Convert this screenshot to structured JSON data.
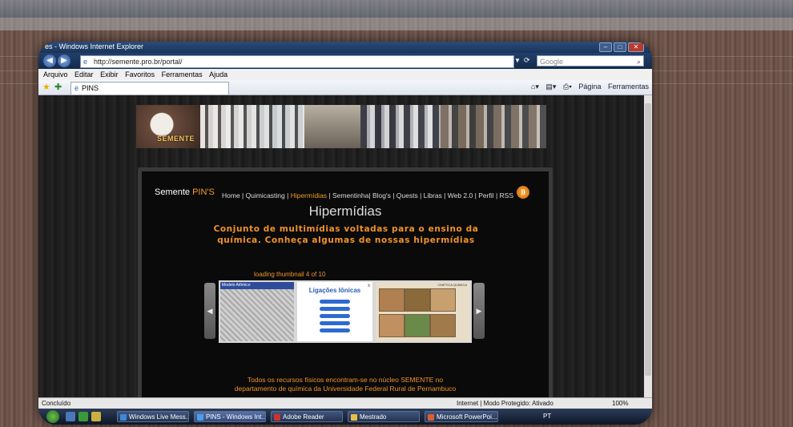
{
  "background": {
    "taskbar_items": [
      "",
      "",
      "",
      "",
      "",
      "",
      ""
    ],
    "address_text": "",
    "right_text": ""
  },
  "window": {
    "title": "es - Windows Internet Explorer",
    "address": "http://semente.pro.br/portal/",
    "search_placeholder": "Google",
    "menu": [
      "Arquivo",
      "Editar",
      "Exibir",
      "Favoritos",
      "Ferramentas",
      "Ajuda"
    ],
    "tab_label": "PINS",
    "command_bar": [
      "Página",
      "Ferramentas"
    ]
  },
  "page": {
    "banner_logo": "SEMENTE",
    "site_title_main": "Semente ",
    "site_title_accent": "PIN'S",
    "nav": {
      "home": "Home",
      "quimicasting": "Quimicasting",
      "hipermidias": "Hipermídias",
      "sementinha": "Sementinha",
      "blogs": "Blog's",
      "quests": "Quests",
      "libras": "Libras",
      "web20": "Web 2.0",
      "perfil": "Perfil",
      "rss": "RSS"
    },
    "heading": "Hipermídias",
    "subheading": "Conjunto de multimídias voltadas para o ensino da química. Conheça algumas de nossas hipermídias",
    "loading_text": "loading thumbnail 4 of 10",
    "thumb1_header": "Modelo Atômico",
    "thumb2_title": "Ligações Iônicas",
    "thumb3_header": "CINÉTICA QUÍMICA",
    "footer_line1": "Todos os recursos físicos encontram-se no núcleo SEMENTE no",
    "footer_line2": "departamento de química da  Universidade Federal Rural de Pernambuco"
  },
  "status": {
    "left": "Concluído",
    "zone": "Internet | Modo Protegido: Ativado",
    "zoom": "100%"
  },
  "taskbar": {
    "buttons": [
      "Windows Live Mess...",
      "PINS - Windows Int...",
      "Adobe Reader",
      "Mestrado",
      "Microsoft PowerPoi..."
    ],
    "tray_lang": "PT"
  },
  "colors": {
    "accent_orange": "#f09a2a",
    "panel_bg": "#0a0a0a"
  }
}
